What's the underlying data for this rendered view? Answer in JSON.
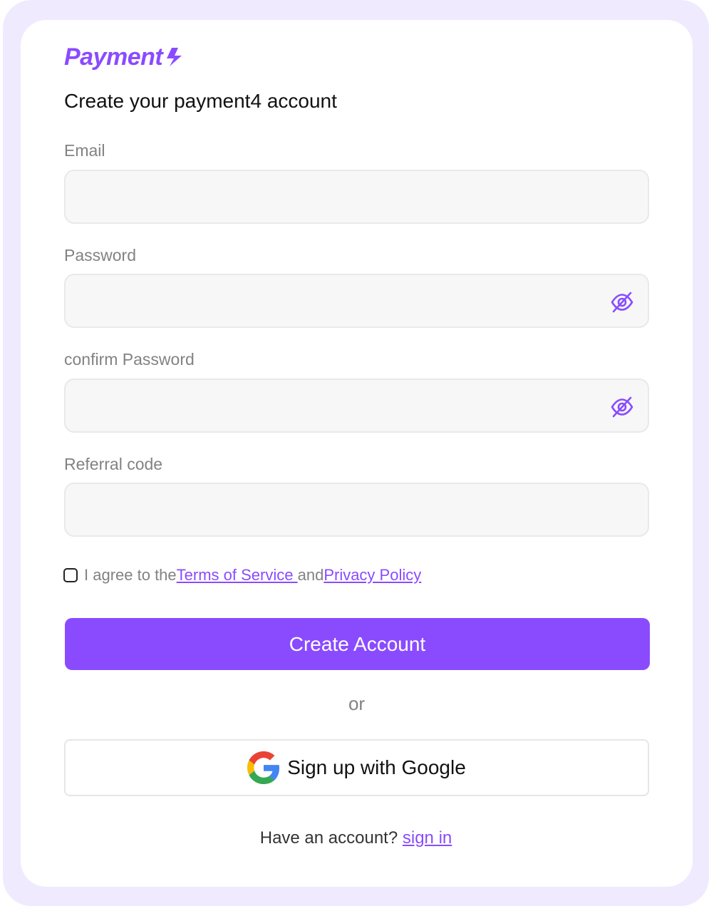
{
  "brand": {
    "name": "Payment",
    "accent_color": "#8a4bff"
  },
  "heading": "Create your payment4 account",
  "fields": {
    "email": {
      "label": "Email",
      "value": "",
      "placeholder": ""
    },
    "password": {
      "label": "Password",
      "value": "",
      "placeholder": ""
    },
    "confirm_password": {
      "label": "confirm Password",
      "value": "",
      "placeholder": ""
    },
    "referral": {
      "label": "Referral code",
      "value": "",
      "placeholder": ""
    }
  },
  "agreement": {
    "prefix": "I agree to the",
    "terms_link": "Terms of Service ",
    "middle": "and",
    "privacy_link": "Privacy Policy",
    "checked": false
  },
  "create_button": "Create Account",
  "divider": "or",
  "google_button": "Sign up with Google",
  "footer": {
    "text": "Have an account? ",
    "signin_link": "sign in"
  }
}
